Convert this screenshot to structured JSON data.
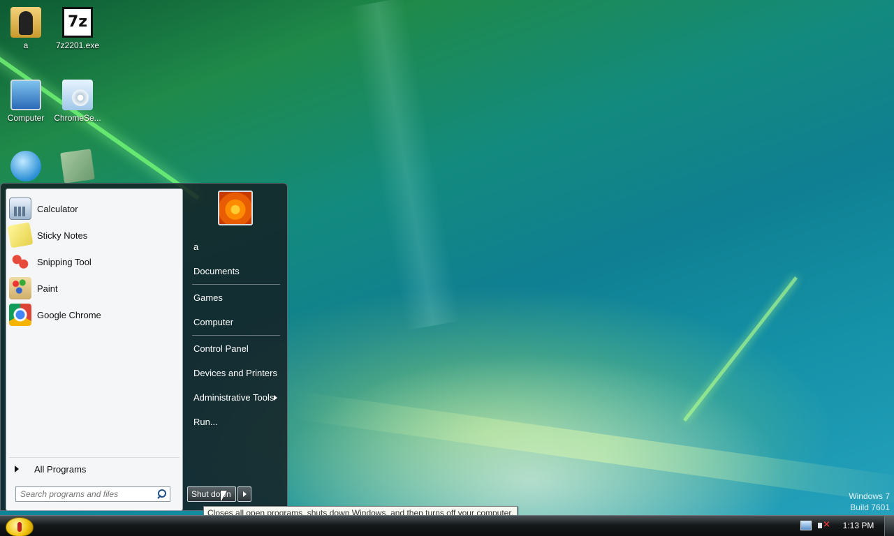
{
  "desktop": {
    "icons": [
      {
        "label": "a",
        "icon": "user-folder-icon"
      },
      {
        "label": "7z2201.exe",
        "icon": "7zip-icon",
        "glyph": "7z"
      },
      {
        "label": "Computer",
        "icon": "computer-icon"
      },
      {
        "label": "ChromeSe...",
        "icon": "setup-disc-icon"
      },
      {
        "label": "",
        "icon": "network-icon"
      },
      {
        "label": "",
        "icon": "recycle-bin-icon"
      }
    ],
    "watermark": {
      "line1": "Windows 7",
      "line2": "Build 7601"
    }
  },
  "start_menu": {
    "pinned_programs": [
      {
        "label": "Calculator",
        "icon": "calculator-icon"
      },
      {
        "label": "Sticky Notes",
        "icon": "sticky-notes-icon"
      },
      {
        "label": "Snipping Tool",
        "icon": "snipping-tool-icon"
      },
      {
        "label": "Paint",
        "icon": "paint-icon"
      },
      {
        "label": "Google Chrome",
        "icon": "chrome-icon"
      }
    ],
    "all_programs_label": "All Programs",
    "search_placeholder": "Search programs and files",
    "right_pane": {
      "user_name": "a",
      "items": [
        "Documents",
        "Games",
        "Computer",
        "Control Panel",
        "Devices and Printers",
        "Administrative Tools",
        "Run..."
      ]
    },
    "shutdown_label": "Shut down"
  },
  "tooltip": "Closes all open programs, shuts down Windows, and then turns off your computer.",
  "taskbar": {
    "clock": "1:13 PM",
    "tray_icons": [
      "network-icon",
      "volume-muted-icon"
    ]
  }
}
